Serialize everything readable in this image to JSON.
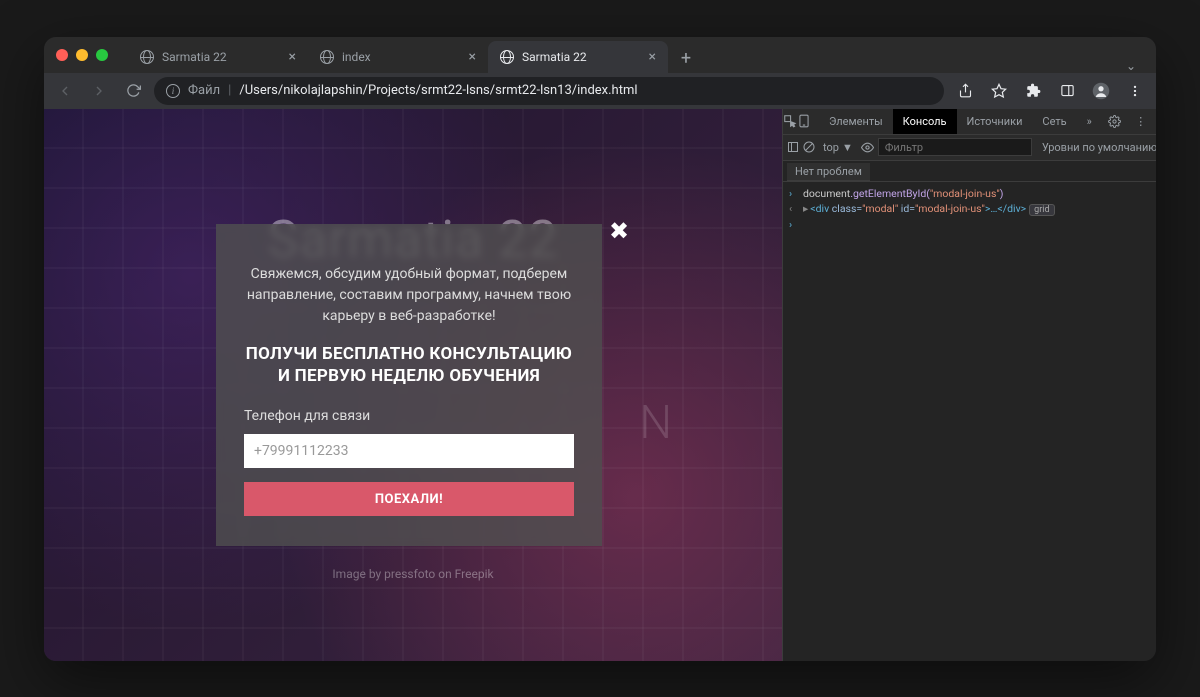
{
  "browser": {
    "tabs": [
      {
        "title": "Sarmatia 22",
        "active": false
      },
      {
        "title": "index",
        "active": false
      },
      {
        "title": "Sarmatia 22",
        "active": true
      }
    ],
    "address_label": "Файл",
    "address_path": "/Users/nikolajlapshin/Projects/srmt22-lsns/srmt22-lsn13/index.html"
  },
  "page": {
    "hero_title": "Sarmatia 22",
    "bg_letters": "N",
    "image_credit": "Image by pressfoto on Freepik",
    "modal": {
      "subtitle": "Свяжемся, обсудим удобный формат, подберем направление, составим программу, начнем твою карьеру в веб-разработке!",
      "title": "ПОЛУЧИ БЕСПЛАТНО КОНСУЛЬТАЦИЮ И ПЕРВУЮ НЕДЕЛЮ ОБУЧЕНИЯ",
      "phone_label": "Телефон для связи",
      "phone_placeholder": "+79991112233",
      "submit": "ПОЕХАЛИ!",
      "close": "✖"
    }
  },
  "devtools": {
    "tabs": {
      "elements": "Элементы",
      "console": "Консоль",
      "sources": "Источники",
      "network": "Сеть",
      "more": "»"
    },
    "toolbar": {
      "top": "top",
      "filter_placeholder": "Фильтр",
      "levels": "Уровни по умолчанию ▼"
    },
    "status": "Нет проблем",
    "console": {
      "input_obj": "document",
      "input_method": ".getElementById(",
      "input_str": "\"modal-join-us\"",
      "input_close": ")",
      "out_open": "<div ",
      "out_attr1": "class=",
      "out_val1": "\"modal\"",
      "out_attr2": " id=",
      "out_val2": "\"modal-join-us\"",
      "out_mid": ">…</div>",
      "out_badge": "grid"
    }
  }
}
